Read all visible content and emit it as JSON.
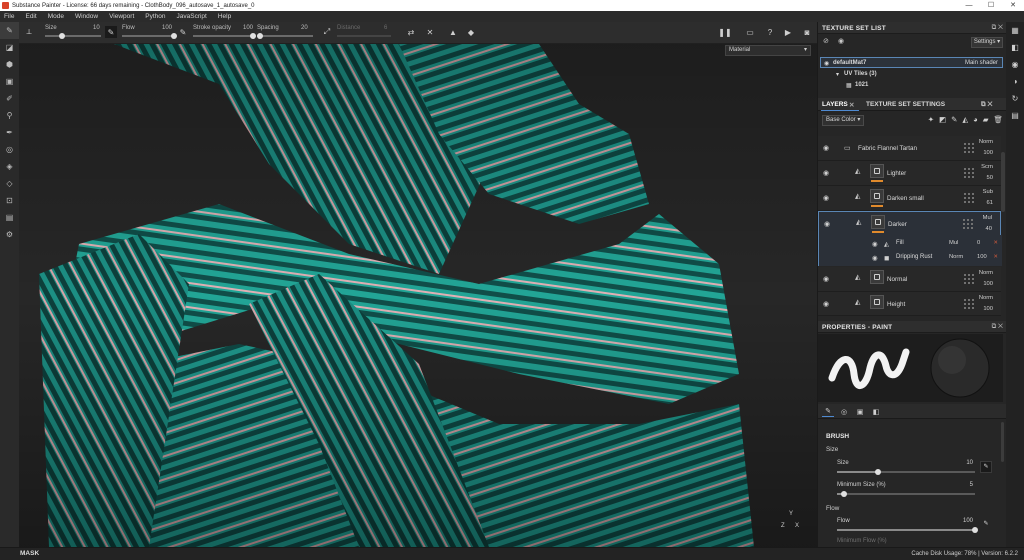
{
  "window": {
    "title": "Substance Painter - License: 66 days remaining - ClothBody_096_autosave_1_autosave_0",
    "controls": [
      "—",
      "☐",
      "✕"
    ]
  },
  "menu": [
    "File",
    "Edit",
    "Mode",
    "Window",
    "Viewport",
    "Python",
    "JavaScript",
    "Help"
  ],
  "toolbar": {
    "size_label": "Size",
    "size_value": "10",
    "size_fraction": 0.3,
    "flow_label": "Flow",
    "flow_value": "100",
    "flow_fraction": 1.0,
    "stroke_opacity_label": "Stroke opacity",
    "stroke_opacity_value": "100",
    "stroke_opacity_fraction": 1.0,
    "spacing_label": "Spacing",
    "spacing_value": "20",
    "spacing_fraction": 0.05,
    "distance_label": "Distance",
    "distance_value": "6"
  },
  "viewport": {
    "mode": "Material",
    "axis": {
      "x": "X",
      "y": "Y",
      "z": "Z"
    }
  },
  "status": {
    "mask": "MASK",
    "cache": "Cache Disk Usage:  78% | Version: 6.2.2"
  },
  "texture_set_list": {
    "title": "TEXTURE SET LIST",
    "settings": "Settings",
    "material": "defaultMat7",
    "shader": "Main shader",
    "uv_tiles": "UV Tiles (3)",
    "tile": "1021"
  },
  "layers_panel": {
    "tab_layers": "LAYERS",
    "tab_settings": "TEXTURE SET SETTINGS",
    "channel": "Base Color",
    "layers": [
      {
        "name": "Fabric Flannel Tartan",
        "blend": "Norm",
        "opacity": "100",
        "type": "folder"
      },
      {
        "name": "Lighter",
        "blend": "Scrn",
        "opacity": "50",
        "type": "fill"
      },
      {
        "name": "Darken small",
        "blend": "Sub",
        "opacity": "61",
        "type": "fill"
      },
      {
        "name": "Darker",
        "blend": "Mul",
        "opacity": "40",
        "type": "fill",
        "selected": true
      },
      {
        "name": "Normal",
        "blend": "Norm",
        "opacity": "100",
        "type": "fill"
      },
      {
        "name": "Height",
        "blend": "Norm",
        "opacity": "100",
        "type": "fill"
      }
    ],
    "sublayers": [
      {
        "name": "Fill",
        "blend": "Mul",
        "value": "0"
      },
      {
        "name": "Dripping Rust",
        "blend": "Norm",
        "value": "100"
      }
    ]
  },
  "properties": {
    "title": "PROPERTIES - PAINT",
    "section": "BRUSH",
    "size_group": "Size",
    "size_label": "Size",
    "size_value": "10",
    "size_fraction": 0.3,
    "min_size_label": "Minimum Size (%)",
    "min_size_value": "5",
    "min_size_fraction": 0.05,
    "flow_group": "Flow",
    "flow_label": "Flow",
    "flow_value": "100",
    "flow_fraction": 1.0,
    "min_flow_label": "Minimum Flow (%)"
  },
  "colors": {
    "accent": "#4f8ad1",
    "cloth_teal": "#1f9a8e",
    "cloth_dark": "#0f4a46",
    "stripe_pink": "#d8a3a8",
    "layer_tag": "#e08a2c"
  }
}
